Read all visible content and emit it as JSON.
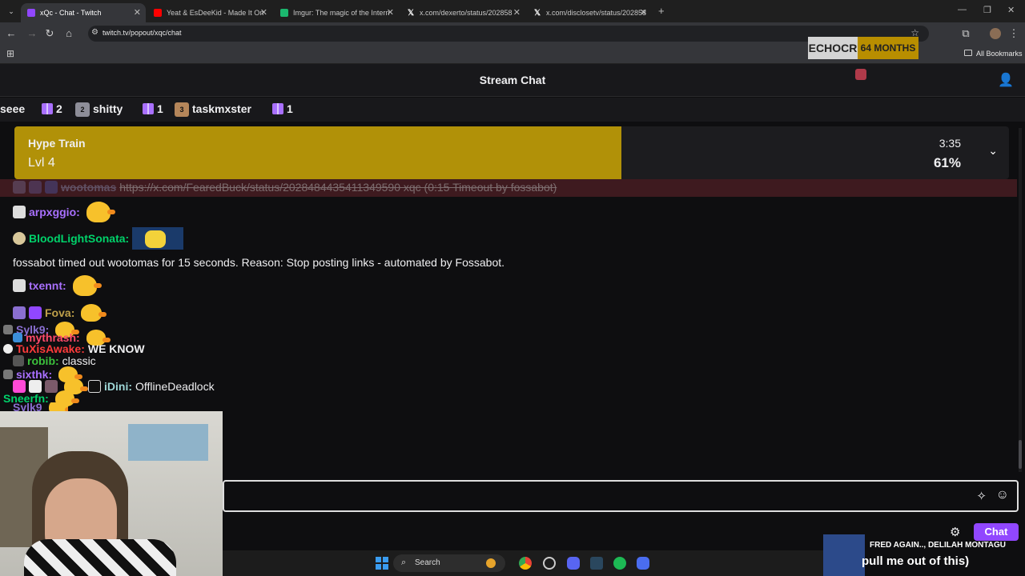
{
  "browser": {
    "tabs": [
      {
        "title": "xQc - Chat - Twitch",
        "active": true,
        "favicon_color": "#9147ff"
      },
      {
        "title": "Yeat & EsDeeKid - Made It On",
        "favicon_color": "#ff0000"
      },
      {
        "title": "Imgur: The magic of the Intern",
        "favicon_color": "#1bb76e"
      },
      {
        "title": "x.com/dexerto/status/202858",
        "favicon_color": "#000000"
      },
      {
        "title": "x.com/disclosetv/status/202858",
        "favicon_color": "#000000"
      }
    ],
    "new_tab_label": "+",
    "url": "twitch.tv/popout/xqc/chat",
    "bookmarks_label": "All Bookmarks"
  },
  "overlay": {
    "sub_name": "ECHOCR",
    "sub_months": "64 MONTHS",
    "music_artist": "FRED AGAIN.., DELILAH MONTAGU",
    "music_title": "pull me out of this)"
  },
  "chat": {
    "header_title": "Stream Chat",
    "gifters": [
      {
        "name": "seee",
        "rank": ""
      },
      {
        "name": "",
        "count": "2"
      },
      {
        "name": "shitty",
        "rank": "2"
      },
      {
        "name": "",
        "count": "1"
      },
      {
        "name": "taskmxster",
        "rank": "3"
      },
      {
        "name": "",
        "count": "1"
      }
    ],
    "hype_train": {
      "label": "Hype Train",
      "level": "Lvl 4",
      "time_left": "3:35",
      "percent": "61%",
      "progress": 0.61
    },
    "messages": [
      {
        "user": "wootomas",
        "color": "#7c7c9a",
        "text": "https://x.com/FearedBuck/status/2028484435411349590 xqc (0:15 Timeout by fossabot)",
        "timeout": true
      },
      {
        "user": "arpxggio",
        "suffix": ":",
        "color": "#a970ff",
        "emote": "duck"
      },
      {
        "user": "BloodLightSonata",
        "suffix": ":",
        "color": "#00d26a",
        "emote": "minion"
      },
      {
        "system": "fossabot timed out wootomas for 15 seconds. Reason: Stop posting links - automated by Fossabot."
      },
      {
        "user": "txennt",
        "suffix": ":",
        "color": "#a970ff",
        "emote": "duck"
      },
      {
        "user": "Fova",
        "suffix": ":",
        "color": "#bfa04a",
        "emote": "duck"
      },
      {
        "user": "Sylk9",
        "suffix": ":",
        "color": "#8a6fd1",
        "emote": "duck"
      },
      {
        "user": "mythrash",
        "suffix": ":",
        "color": "#ff4a6a",
        "emote": "duck"
      },
      {
        "user": "TuXisAwake",
        "suffix": ":",
        "color": "#ff3b3b",
        "text": "WE KNOW"
      },
      {
        "user": "robib",
        "suffix": ":",
        "color": "#3cc13c",
        "text": "classic"
      },
      {
        "user": "sixthk",
        "suffix": ":",
        "color": "#a970ff",
        "emote": "duck"
      },
      {
        "user": "iDini",
        "suffix": ":",
        "color": "#9fd7d7",
        "text": "OfflineDeadlock"
      },
      {
        "user": "Sneerfn",
        "suffix": ":",
        "color": "#00d26a",
        "emote": "duck"
      },
      {
        "user": "Sylk9",
        "color": "#8a6fd1",
        "emote": "duck"
      }
    ],
    "chat_button": "Chat"
  },
  "taskbar": {
    "search_placeholder": "Search"
  }
}
